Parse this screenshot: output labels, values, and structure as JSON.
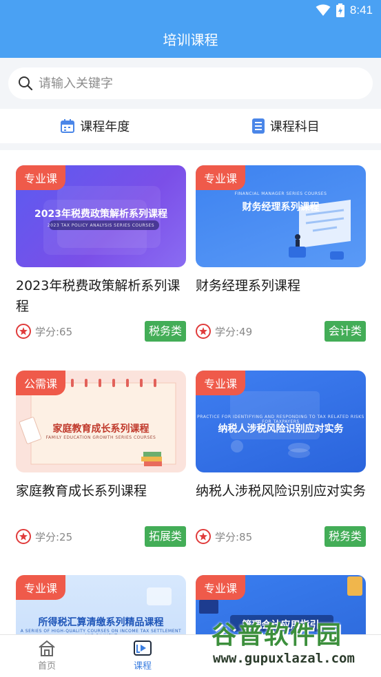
{
  "status": {
    "time": "8:41"
  },
  "header": {
    "title": "培训课程"
  },
  "search": {
    "placeholder": "请输入关键字"
  },
  "filters": [
    {
      "label": "课程年度",
      "icon": "calendar-icon"
    },
    {
      "label": "课程科目",
      "icon": "list-icon"
    }
  ],
  "courses": [
    {
      "tag": "专业课",
      "banner": "2023年税费政策解析系列课程",
      "banner_sub": "2023 TAX POLICY ANALYSIS SERIES COURSES",
      "name": "2023年税费政策解析系列课程",
      "credit": "学分:65",
      "category": "税务类"
    },
    {
      "tag": "专业课",
      "banner": "财务经理系列课程",
      "banner_sub": "FINANCIAL MANAGER SERIES COURSES",
      "name": "财务经理系列课程",
      "credit": "学分:49",
      "category": "会计类"
    },
    {
      "tag": "公需课",
      "banner": "家庭教育成长系列课程",
      "banner_sub": "FAMILY EDUCATION GROWTH SERIES COURSES",
      "name": "家庭教育成长系列课程",
      "credit": "学分:25",
      "category": "拓展类"
    },
    {
      "tag": "专业课",
      "banner": "纳税人涉税风险识别应对实务",
      "banner_sub": "PRACTICE FOR IDENTIFYING AND RESPONDING TO TAX RELATED RISKS FOR TAXPAYERS",
      "name": "纳税人涉税风险识别应对实务",
      "credit": "学分:85",
      "category": "税务类"
    },
    {
      "tag": "专业课",
      "banner": "所得税汇算清缴系列精品课程",
      "banner_sub": "A SERIES OF HIGH-QUALITY COURSES ON INCOME TAX SETTLEMENT AND PAYMENT"
    },
    {
      "tag": "专业课",
      "banner": "管理会计应用指引"
    }
  ],
  "nav": [
    {
      "label": "首页",
      "icon": "home-icon"
    },
    {
      "label": "课程",
      "icon": "course-play-icon"
    }
  ],
  "watermark": {
    "title": "谷普软件园",
    "url": "www.gupuxlazal.com"
  },
  "colors": {
    "header": "#4aa1f3",
    "tag": "#ef5a4a",
    "category": "#43ad57",
    "nav_active": "#3b7ee0"
  }
}
